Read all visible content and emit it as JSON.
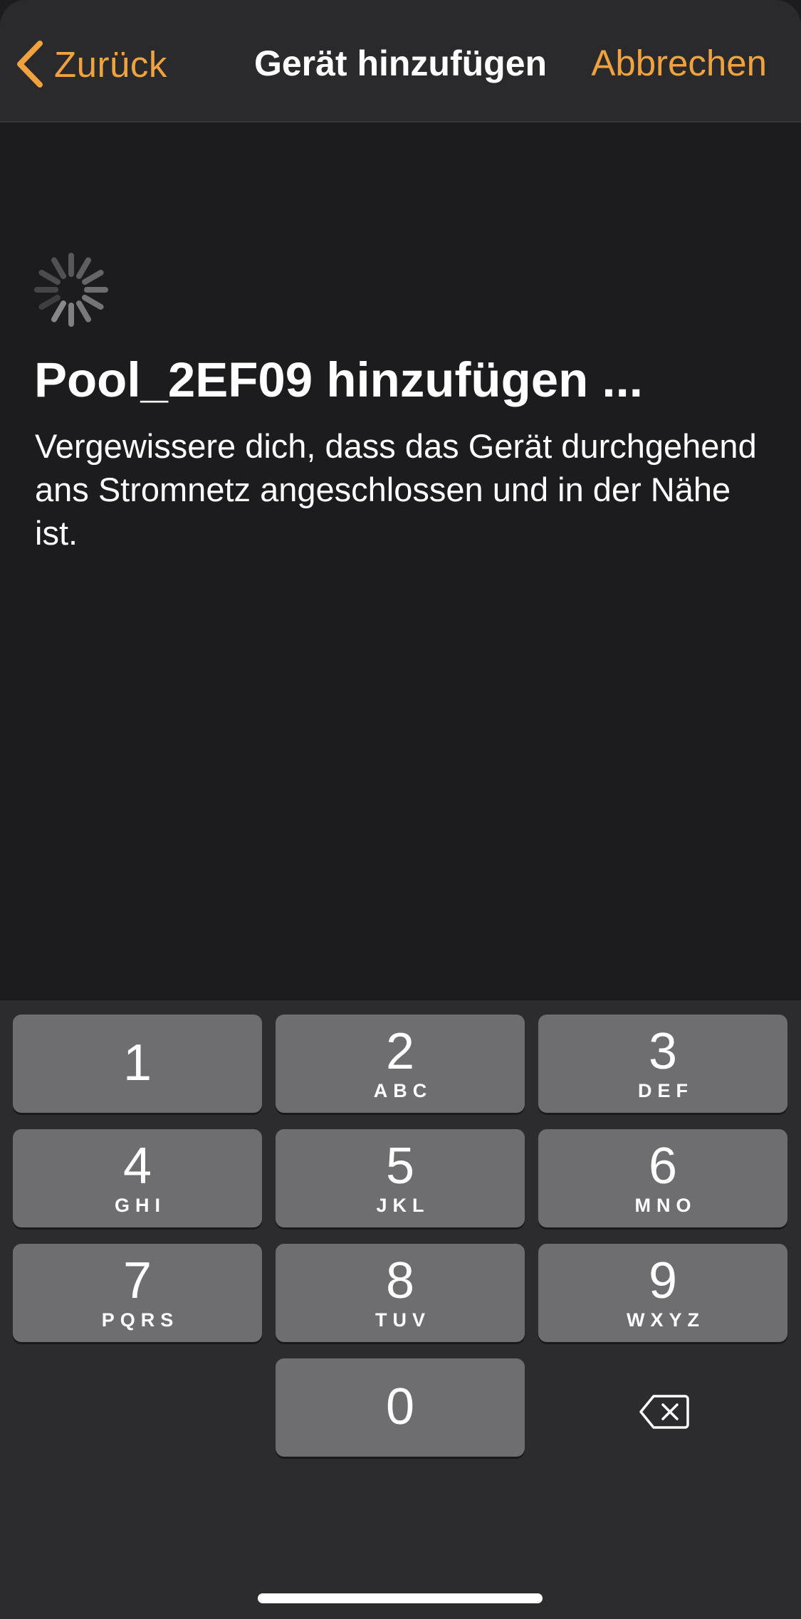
{
  "navbar": {
    "back_label": "Zurück",
    "title": "Gerät hinzufügen",
    "cancel_label": "Abbrechen"
  },
  "content": {
    "heading": "Pool_2EF09 hinzufügen ...",
    "description": "Vergewissere dich, dass das Gerät durchgehend ans Stromnetz angeschlossen und in der Nähe ist."
  },
  "keypad": {
    "keys": [
      {
        "digit": "1",
        "letters": ""
      },
      {
        "digit": "2",
        "letters": "ABC"
      },
      {
        "digit": "3",
        "letters": "DEF"
      },
      {
        "digit": "4",
        "letters": "GHI"
      },
      {
        "digit": "5",
        "letters": "JKL"
      },
      {
        "digit": "6",
        "letters": "MNO"
      },
      {
        "digit": "7",
        "letters": "PQRS"
      },
      {
        "digit": "8",
        "letters": "TUV"
      },
      {
        "digit": "9",
        "letters": "WXYZ"
      },
      {
        "digit": "0",
        "letters": ""
      }
    ],
    "delete_icon": "delete-backspace-icon"
  },
  "colors": {
    "accent": "#f0a23e",
    "background": "#1c1c1e",
    "navbar": "#2a2a2c",
    "keypad_background": "#2c2c2e",
    "key": "#6e6e70"
  }
}
